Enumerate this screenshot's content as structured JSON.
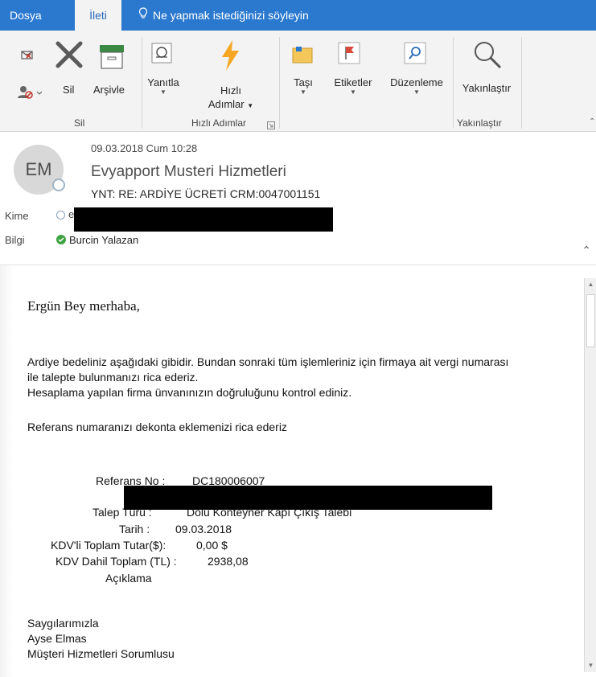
{
  "tabs": {
    "dosya": "Dosya",
    "ileti": "İleti",
    "tell_me": "Ne yapmak istediğinizi söyleyin"
  },
  "ribbon": {
    "sil": "Sil",
    "arsivle": "Arşivle",
    "yanitla": "Yanıtla",
    "hizli_line1": "Hızlı",
    "hizli_line2": "Adımlar",
    "tasi": "Taşı",
    "etiketler": "Etiketler",
    "duzenleme": "Düzenleme",
    "yakinlastir": "Yakınlaştır",
    "group_sil": "Sil",
    "group_hizli": "Hızlı Adımlar",
    "group_yakinlastir": "Yakınlaştır"
  },
  "header": {
    "avatar_initials": "EM",
    "date": "09.03.2018 Cum 10:28",
    "sender": "Evyapport Musteri Hizmetleri",
    "subject": "YNT: RE: ARDİYE ÜCRETİ   CRM:0047001151",
    "kime_label": "Kime",
    "kime_value_visible": "e",
    "bilgi_label": "Bilgi",
    "bilgi_value": "Burcin Yalazan"
  },
  "body": {
    "greeting": "Ergün Bey merhaba,",
    "para1_line1": "Ardiye bedeliniz aşağıdaki gibidir. Bundan sonraki tüm işlemleriniz için firmaya ait vergi numarası",
    "para1_line2": "ile talepte bulunmanızı rica ederiz.",
    "para1_line3": "Hesaplama yapılan firma ünvanınızın doğruluğunu kontrol ediniz.",
    "para2": "Referans numaranızı dekonta eklemenizi rica ederiz",
    "ref_label": "Referans No :",
    "ref_value": "DC180006007",
    "talep_label": "Talep Türü :",
    "talep_value": "Dolu Konteyner Kapı Çıkış Talebi",
    "tarih_label": "Tarih :",
    "tarih_value": "09.03.2018",
    "kdvli_label": "KDV'li Toplam Tutar($):",
    "kdvli_value": "0,00 $",
    "kdvdahil_label": "KDV Dahil Toplam (TL) :",
    "kdvdahil_value": "2938,08",
    "aciklama_label": "Açıklama",
    "sign1": "Saygılarımızla",
    "sign2": "Ayse Elmas",
    "sign3": "Müşteri Hizmetleri Sorumlusu"
  }
}
